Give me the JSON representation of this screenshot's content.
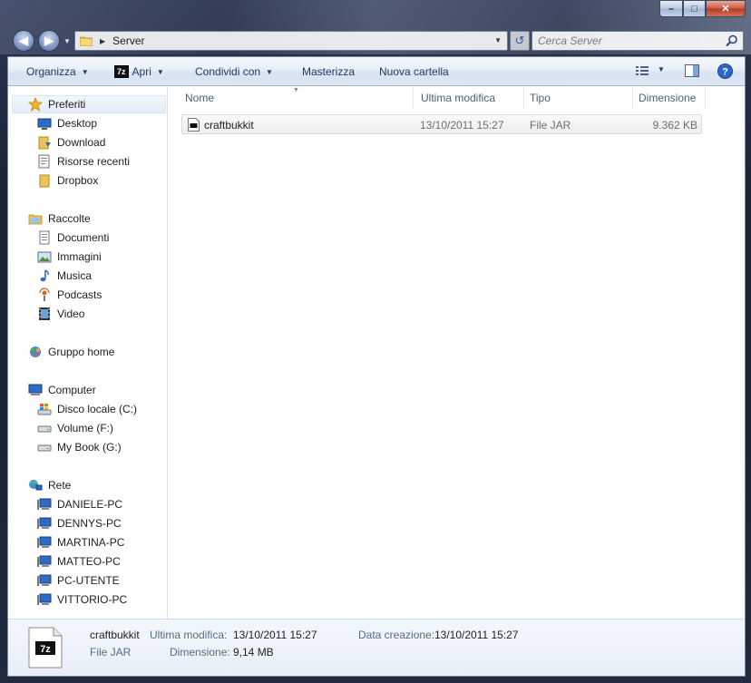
{
  "window": {
    "caption": {
      "minimize": "–",
      "maximize": "□",
      "close": "✕"
    }
  },
  "nav": {
    "back_glyph": "◀",
    "forward_glyph": "▶",
    "address_separator": "▶",
    "address_path": "Server",
    "refresh_glyph": "↺",
    "search_placeholder": "Cerca Server"
  },
  "toolbar": {
    "organize": "Organizza",
    "open_7z_badge": "7z",
    "open": "Apri",
    "share": "Condividi con",
    "burn": "Masterizza",
    "new_folder": "Nuova cartella",
    "help_glyph": "?"
  },
  "sidebar": {
    "favorites": {
      "label": "Preferiti",
      "items": [
        "Desktop",
        "Download",
        "Risorse recenti",
        "Dropbox"
      ]
    },
    "libraries": {
      "label": "Raccolte",
      "items": [
        "Documenti",
        "Immagini",
        "Musica",
        "Podcasts",
        "Video"
      ]
    },
    "homegroup": {
      "label": "Gruppo home"
    },
    "computer": {
      "label": "Computer",
      "items": [
        "Disco locale (C:)",
        "Volume (F:)",
        "My Book (G:)"
      ]
    },
    "network": {
      "label": "Rete",
      "items": [
        "DANIELE-PC",
        "DENNYS-PC",
        "MARTINA-PC",
        "MATTEO-PC",
        "PC-UTENTE",
        "VITTORIO-PC"
      ]
    }
  },
  "columns": {
    "name": "Nome",
    "modified": "Ultima modifica",
    "type": "Tipo",
    "size": "Dimensione"
  },
  "files": [
    {
      "name": "craftbukkit",
      "modified": "13/10/2011 15:27",
      "type": "File JAR",
      "size": "9.362 KB"
    }
  ],
  "details": {
    "name": "craftbukkit",
    "type": "File JAR",
    "modified_label": "Ultima modifica:",
    "modified_value": "13/10/2011 15:27",
    "size_label": "Dimensione:",
    "size_value": "9,14 MB",
    "created_label": "Data creazione:",
    "created_value": "13/10/2011 15:27",
    "icon_badge": "7z"
  },
  "colors": {
    "accent": "#1e395b",
    "selection": "#e3ecf7",
    "close": "#c75a42"
  }
}
